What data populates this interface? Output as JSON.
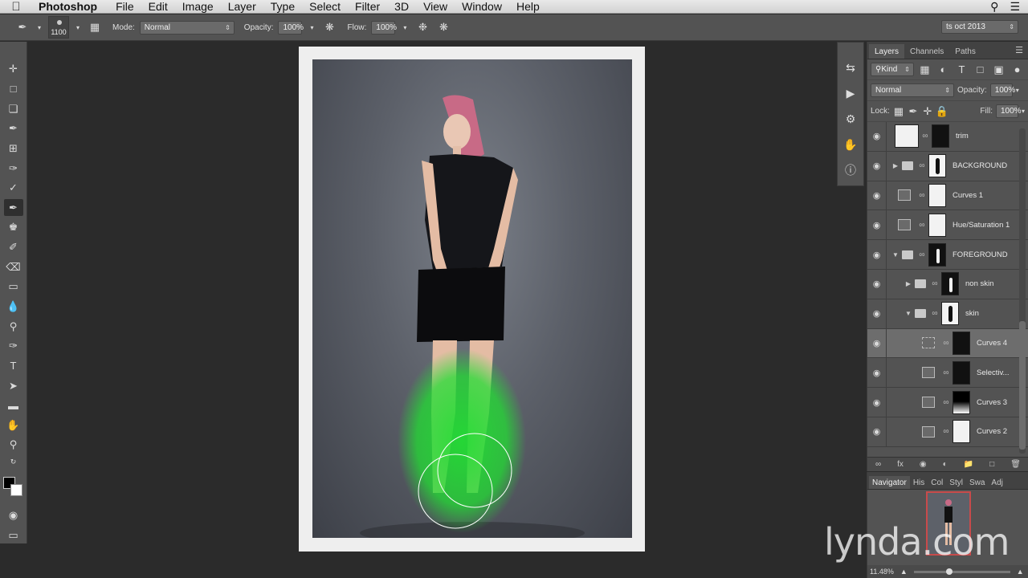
{
  "menubar": {
    "apple": "",
    "app": "Photoshop",
    "items": [
      "File",
      "Edit",
      "Image",
      "Layer",
      "Type",
      "Select",
      "Filter",
      "3D",
      "View",
      "Window",
      "Help"
    ]
  },
  "options": {
    "brush_size": "1100",
    "mode_label": "Mode:",
    "mode_value": "Normal",
    "opacity_label": "Opacity:",
    "opacity_value": "100%",
    "flow_label": "Flow:",
    "flow_value": "100%",
    "workspace": "ts oct 2013"
  },
  "layers_panel": {
    "tabs": [
      "Layers",
      "Channels",
      "Paths"
    ],
    "filter_kind": "Kind",
    "blend_mode": "Normal",
    "opacity_label": "Opacity:",
    "opacity_value": "100%",
    "lock_label": "Lock:",
    "fill_label": "Fill:",
    "fill_value": "100%",
    "layers": [
      {
        "name": "trim"
      },
      {
        "name": "BACKGROUND"
      },
      {
        "name": "Curves 1"
      },
      {
        "name": "Hue/Saturation 1"
      },
      {
        "name": "FOREGROUND"
      },
      {
        "name": "non skin"
      },
      {
        "name": "skin"
      },
      {
        "name": "Curves 4"
      },
      {
        "name": "Selectiv..."
      },
      {
        "name": "Curves 3"
      },
      {
        "name": "Curves 2"
      }
    ]
  },
  "navigator": {
    "tabs": [
      "Navigator",
      "His",
      "Col",
      "Styl",
      "Swa",
      "Adj"
    ],
    "zoom": "11.48%"
  },
  "watermark": "lynda.com",
  "colors": {
    "mask_overlay": "#22dd33",
    "panel_bg": "#535353",
    "canvas_bg": "#2b2b2b"
  }
}
